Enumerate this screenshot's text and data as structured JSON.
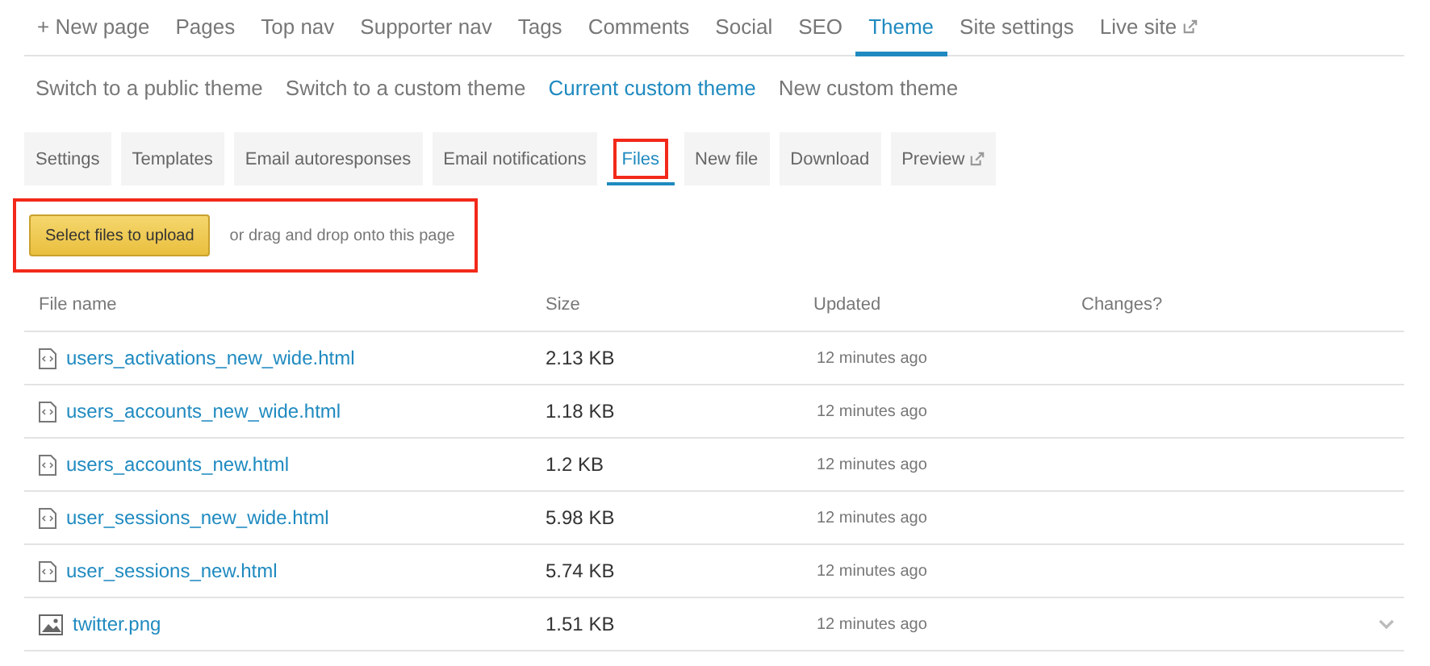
{
  "top_nav": [
    {
      "label": "+ New page",
      "selected": false,
      "external": false
    },
    {
      "label": "Pages",
      "selected": false,
      "external": false
    },
    {
      "label": "Top nav",
      "selected": false,
      "external": false
    },
    {
      "label": "Supporter nav",
      "selected": false,
      "external": false
    },
    {
      "label": "Tags",
      "selected": false,
      "external": false
    },
    {
      "label": "Comments",
      "selected": false,
      "external": false
    },
    {
      "label": "Social",
      "selected": false,
      "external": false
    },
    {
      "label": "SEO",
      "selected": false,
      "external": false
    },
    {
      "label": "Theme",
      "selected": true,
      "external": false
    },
    {
      "label": "Site settings",
      "selected": false,
      "external": false
    },
    {
      "label": "Live site",
      "selected": false,
      "external": true
    }
  ],
  "sub_nav": [
    {
      "label": "Switch to a public theme",
      "selected": false
    },
    {
      "label": "Switch to a custom theme",
      "selected": false
    },
    {
      "label": "Current custom theme",
      "selected": true
    },
    {
      "label": "New custom theme",
      "selected": false
    }
  ],
  "tabs": [
    {
      "label": "Settings",
      "selected": false,
      "highlighted": false,
      "external": false
    },
    {
      "label": "Templates",
      "selected": false,
      "highlighted": false,
      "external": false
    },
    {
      "label": "Email autoresponses",
      "selected": false,
      "highlighted": false,
      "external": false
    },
    {
      "label": "Email notifications",
      "selected": false,
      "highlighted": false,
      "external": false
    },
    {
      "label": "Files",
      "selected": true,
      "highlighted": true,
      "external": false
    },
    {
      "label": "New file",
      "selected": false,
      "highlighted": false,
      "external": false
    },
    {
      "label": "Download",
      "selected": false,
      "highlighted": false,
      "external": false
    },
    {
      "label": "Preview",
      "selected": false,
      "highlighted": false,
      "external": true
    }
  ],
  "upload": {
    "button": "Select files to upload",
    "hint": "or drag and drop onto this page",
    "highlighted": true
  },
  "table": {
    "columns": [
      "File name",
      "Size",
      "Updated",
      "Changes?"
    ],
    "rows": [
      {
        "kind": "code",
        "name": "users_activations_new_wide.html",
        "size": "2.13 KB",
        "updated": "12 minutes ago",
        "menu": false
      },
      {
        "kind": "code",
        "name": "users_accounts_new_wide.html",
        "size": "1.18 KB",
        "updated": "12 minutes ago",
        "menu": false
      },
      {
        "kind": "code",
        "name": "users_accounts_new.html",
        "size": "1.2 KB",
        "updated": "12 minutes ago",
        "menu": false
      },
      {
        "kind": "code",
        "name": "user_sessions_new_wide.html",
        "size": "5.98 KB",
        "updated": "12 minutes ago",
        "menu": false
      },
      {
        "kind": "code",
        "name": "user_sessions_new.html",
        "size": "5.74 KB",
        "updated": "12 minutes ago",
        "menu": false
      },
      {
        "kind": "image",
        "name": "twitter.png",
        "size": "1.51 KB",
        "updated": "12 minutes ago",
        "menu": true
      }
    ]
  }
}
